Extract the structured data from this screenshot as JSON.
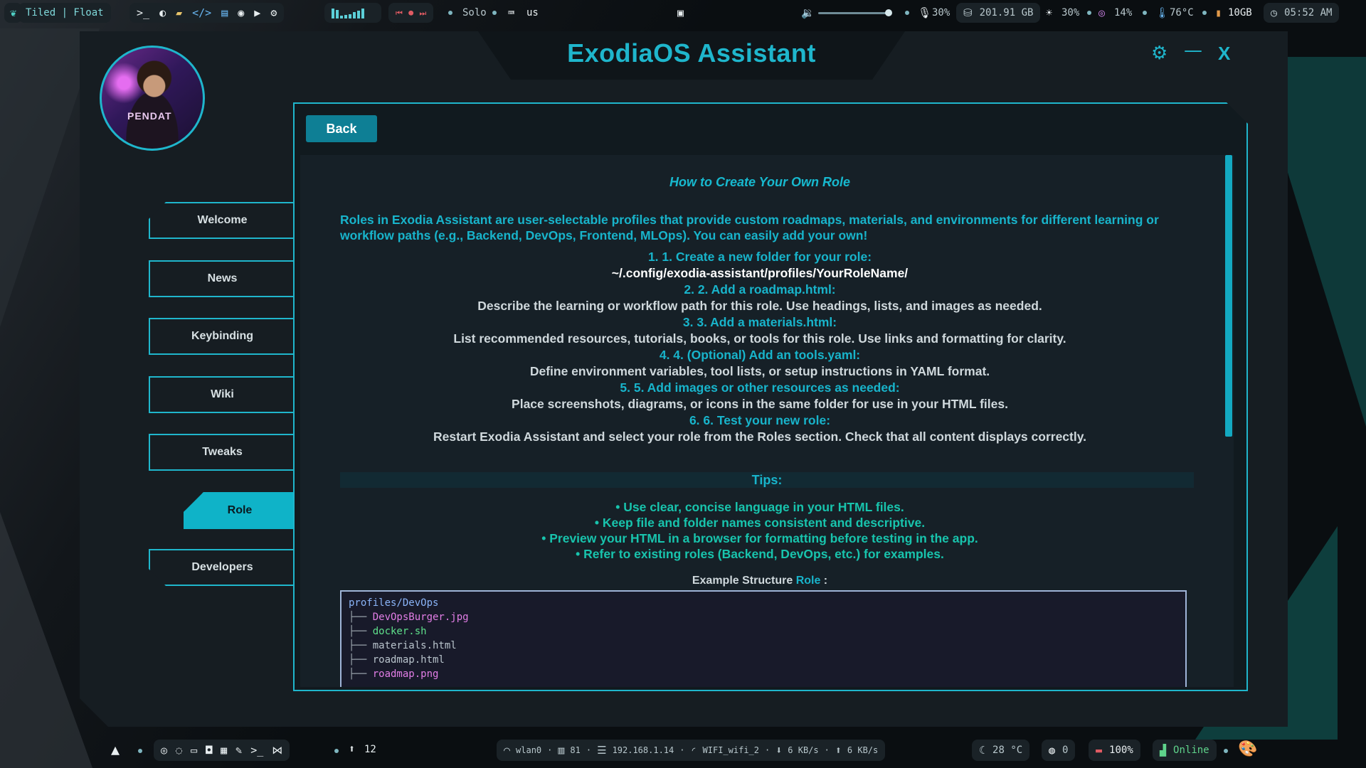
{
  "topbar": {
    "layout_mode": "Tiled | Float",
    "workspace": "Solo",
    "keyboard": "us",
    "volume": "30%",
    "disk": "201.91 GB",
    "brightness": "30%",
    "cpu": "14%",
    "temp": "76°C",
    "memory": "10GB",
    "time": "05:52 AM"
  },
  "window": {
    "title": "ExodiaOS Assistant",
    "avatar_text": "PENDAT",
    "settings_glyph": "⚙",
    "minimize_glyph": "—",
    "close_glyph": "X"
  },
  "sidebar": {
    "items": [
      {
        "label": "Welcome"
      },
      {
        "label": "News"
      },
      {
        "label": "Keybinding"
      },
      {
        "label": "Wiki"
      },
      {
        "label": "Tweaks"
      },
      {
        "label": "Role"
      },
      {
        "label": "Developers"
      }
    ],
    "active": "Role"
  },
  "content": {
    "back_label": "Back",
    "title": "How to Create Your Own Role",
    "intro": "Roles in Exodia Assistant are user-selectable profiles that provide custom roadmaps, materials, and environments for different learning or workflow paths (e.g., Backend, DevOps, Frontend, MLOps). You can easily add your own!",
    "steps": [
      {
        "heading": "1. 1. Create a new folder for your role:",
        "detail": "~/.config/exodia-assistant/profiles/YourRoleName/"
      },
      {
        "heading": "2. 2. Add a roadmap.html:",
        "detail": "Describe the learning or workflow path for this role. Use headings, lists, and images as needed."
      },
      {
        "heading": "3. 3. Add a materials.html:",
        "detail": "List recommended resources, tutorials, books, or tools for this role. Use links and formatting for clarity."
      },
      {
        "heading": "4. 4. (Optional) Add an tools.yaml:",
        "detail": "Define environment variables, tool lists, or setup instructions in YAML format."
      },
      {
        "heading": "5. 5. Add images or other resources as needed:",
        "detail": "Place screenshots, diagrams, or icons in the same folder for use in your HTML files."
      },
      {
        "heading": "6. 6. Test your new role:",
        "detail": "Restart Exodia Assistant and select your role from the Roles section. Check that all content displays correctly."
      }
    ],
    "tips_title": "Tips:",
    "tips": [
      "• Use clear, concise language in your HTML files.",
      "• Keep file and folder names consistent and descriptive.",
      "• Preview your HTML in a browser for formatting before testing in the app.",
      "• Refer to existing roles (Backend, DevOps, etc.) for examples."
    ],
    "example_label": "Example Structure",
    "example_highlight": "Role",
    "example_colon": " :",
    "code_root": "profiles/DevOps",
    "tree_prefix": "├── ",
    "code_files": [
      {
        "name": "DevOpsBurger.jpg",
        "color": "#e27ee6"
      },
      {
        "name": "docker.sh",
        "color": "#5fe08b"
      },
      {
        "name": "materials.html",
        "color": "#b9c4cc"
      },
      {
        "name": "roadmap.html",
        "color": "#b9c4cc"
      },
      {
        "name": "roadmap.png",
        "color": "#e27ee6"
      }
    ]
  },
  "bottombar": {
    "workspace_count": "12",
    "network_iface": "wlan0",
    "network_signal": "81",
    "ip": "192.168.1.14",
    "ssid": "WIFI_wifi_2",
    "down": "6 KB/s",
    "up": "6 KB/s",
    "weather": "28 °C",
    "github": "0",
    "battery": "100%",
    "status": "Online"
  },
  "colors": {
    "accent": "#1fb6cc",
    "active_tab": "#0fb3c8",
    "button": "#0e7f95",
    "tips": "#18c4ad"
  }
}
